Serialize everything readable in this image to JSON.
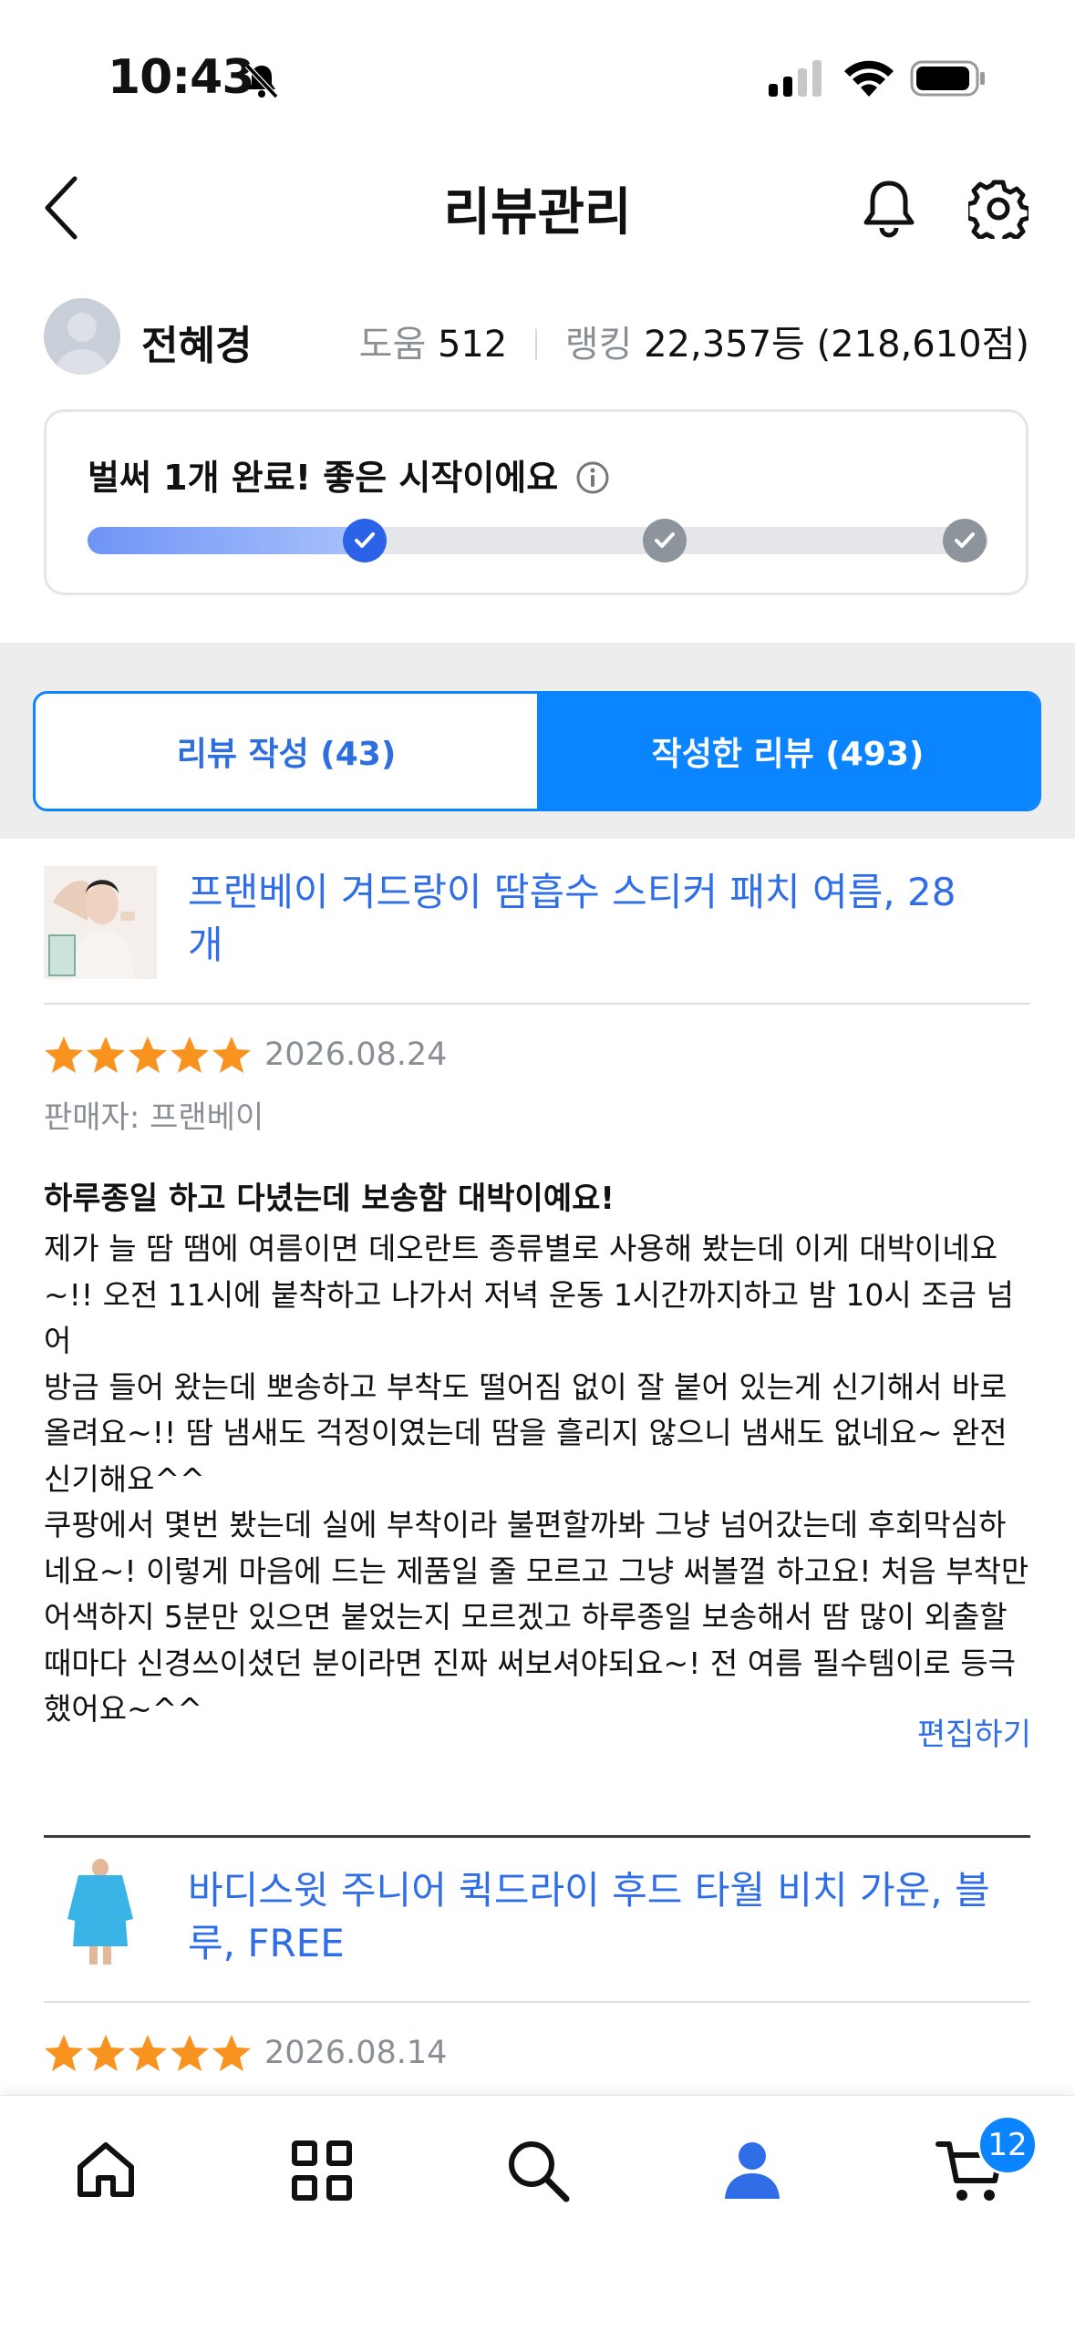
{
  "status_bar": {
    "time": "10:43"
  },
  "header": {
    "title": "리뷰관리"
  },
  "profile": {
    "name": "전혜경",
    "help_label": "도움",
    "help_value": "512",
    "rank_label": "랭킹",
    "rank_value": "22,357등 (218,610점)"
  },
  "progress": {
    "title": "벌써 1개 완료! 좋은 시작이에요",
    "completed_steps": 1,
    "total_steps": 3
  },
  "tabs": [
    {
      "label": "리뷰 작성 (43)",
      "active": false
    },
    {
      "label": "작성한 리뷰 (493)",
      "active": true
    }
  ],
  "reviews": [
    {
      "product_title": "프랜베이 겨드랑이 땀흡수 스티커 패치 여름, 28개",
      "rating": 5,
      "date": "2026.08.24",
      "seller": "판매자: 프랜베이",
      "review_title": "하루종일 하고 다녔는데 보송함 대박이예요!",
      "body": "제가 늘 땀 땜에 여름이면 데오란트 종류별로 사용해 봤는데 이게 대박이네요\n~!! 오전 11시에 붙착하고 나가서 저녁 운동 1시간까지하고 밤 10시 조금 넘어\n방금 들어 왔는데 뽀송하고 부착도 떨어짐 없이 잘 붙어 있는게 신기해서 바로\n올려요~!! 땀 냄새도 걱정이였는데 땀을 흘리지 않으니 냄새도 없네요~ 완전\n신기해요^^\n쿠팡에서 몇번 봤는데 실에 부착이라 불편할까봐 그냥 넘어갔는데 후회막심하\n네요~! 이렇게 마음에 드는 제품일 줄 모르고 그냥 써볼껄 하고요! 처음 부착만\n어색하지 5분만 있으면 붙었는지 모르겠고 하루종일 보송해서 땀 많이 외출할\n때마다 신경쓰이셨던 분이라면 진짜 써보셔야되요~! 전 여름 필수템이로 등극\n했어요~^^",
      "edit_label": "편집하기"
    },
    {
      "product_title": "바디스윗 주니어 퀵드라이 후드 타월 비치 가운, 블루, FREE",
      "rating": 5,
      "date": "2026.08.14"
    }
  ],
  "bottom_nav": {
    "items": [
      "home-icon",
      "categories-icon",
      "search-icon",
      "profile-icon",
      "cart-icon"
    ],
    "active": "profile-icon",
    "cart_badge": "12"
  },
  "colors": {
    "accent": "#0a84ff",
    "link": "#2f6ee6",
    "star": "#f7931e"
  }
}
